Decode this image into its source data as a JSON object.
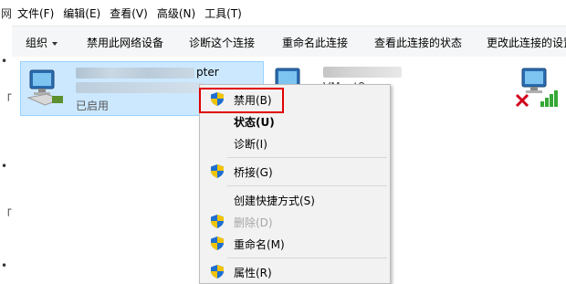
{
  "left_strip": {
    "chars": [
      "网",
      "•",
      "「",
      "•",
      "「",
      "•"
    ]
  },
  "menu": {
    "file": "文件(F)",
    "edit": "编辑(E)",
    "view": "查看(V)",
    "advanced": "高级(N)",
    "tools": "工具(T)"
  },
  "toolbar": {
    "organize": "组织",
    "disable_device": "禁用此网络设备",
    "diagnose": "诊断这个连接",
    "rename": "重命名此连接",
    "view_status": "查看此连接的状态",
    "change_settings": "更改此连接的设置"
  },
  "adapter1": {
    "name_suffix": "pter",
    "status": "已启用"
  },
  "adapter2": {
    "name_fragment": "VMnet8"
  },
  "context_menu": {
    "items": [
      {
        "label": "禁用(B)",
        "shield": true,
        "bold": false,
        "disabled": false
      },
      {
        "label": "状态(U)",
        "shield": false,
        "bold": true,
        "disabled": false
      },
      {
        "label": "诊断(I)",
        "shield": false,
        "bold": false,
        "disabled": false
      },
      {
        "label": "桥接(G)",
        "shield": true,
        "bold": false,
        "disabled": false
      },
      {
        "label": "创建快捷方式(S)",
        "shield": false,
        "bold": false,
        "disabled": false
      },
      {
        "label": "删除(D)",
        "shield": true,
        "bold": false,
        "disabled": true
      },
      {
        "label": "重命名(M)",
        "shield": true,
        "bold": false,
        "disabled": false
      },
      {
        "label": "属性(R)",
        "shield": true,
        "bold": false,
        "disabled": false
      }
    ]
  },
  "colors": {
    "selection_bg": "#cce8ff",
    "highlight_border": "#e10000",
    "toolbar_bg": "#f5f6f7",
    "menu_bg": "#f2f2f2"
  },
  "icons": {
    "shield": "uac-shield-icon",
    "network_adapter": "network-adapter-icon",
    "disconnected": "disconnected-x-icon",
    "signal": "signal-bars-icon"
  }
}
